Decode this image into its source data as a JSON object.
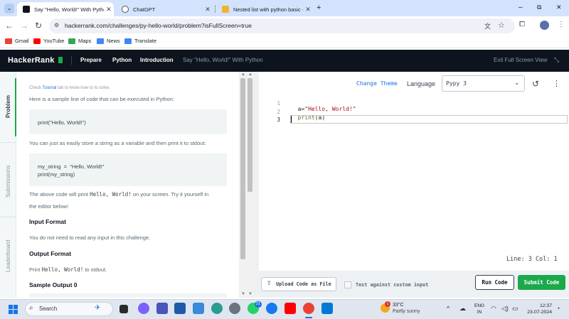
{
  "browser": {
    "tabs": [
      {
        "title": "Say \"Hello, World!\" With Pytho",
        "active": true
      },
      {
        "title": "ChatGPT",
        "active": false
      },
      {
        "title": "Nested list with python basic -",
        "active": false
      }
    ],
    "url": "hackerrank.com/challenges/py-hello-world/problem?isFullScreen=true",
    "bookmarks": [
      "Gmail",
      "YouTube",
      "Maps",
      "News",
      "Translate"
    ]
  },
  "header": {
    "logo": "HackerRank",
    "crumbs": [
      "Prepare",
      "Python",
      "Introduction"
    ],
    "challenge": "Say \"Hello, World!\" With Python",
    "exit_fullscreen": "Exit Full Screen View"
  },
  "side_tabs": [
    "Problem",
    "Submissions",
    "Leaderboard"
  ],
  "problem": {
    "tutorial_prefix": "Check",
    "tutorial_link": "Tutorial",
    "tutorial_suffix": "tab to know how to to solve.",
    "intro": "Here is a sample line of code that can be executed in Python:",
    "code1": "print(\"Hello, World!\")",
    "para2": "You can just as easily store a string as a variable and then print it to stdout:",
    "code2": "my_string  =  \"Hello, World!\"\nprint(my_string)",
    "para3_a": "The above code will print",
    "para3_code": "Hello, World!",
    "para3_b": "on your screen. Try it yourself in",
    "para3_c": "the editor below!",
    "input_format_title": "Input Format",
    "input_format_text": "You do not need to read any input in this challenge.",
    "output_format_title": "Output Format",
    "output_prefix": "Print",
    "output_code": "Hello, World!",
    "output_suffix": "to stdout.",
    "sample_output_title": "Sample Output 0"
  },
  "editor": {
    "change_theme": "Change Theme",
    "language_label": "Language",
    "language_value": "Pypy 3",
    "lines": [
      {
        "num": "1",
        "text_a": "a=",
        "text_b": "\"Hello, World!\""
      },
      {
        "num": "2",
        "text_a": "print",
        "text_b": "(a)"
      },
      {
        "num": "3",
        "text_a": "",
        "text_b": ""
      }
    ],
    "status": "Line: 3 Col: 1",
    "upload_label": "Upload Code as File",
    "custom_input_label": "Test against custom input",
    "run_label": "Run Code",
    "submit_label": "Submit Code"
  },
  "taskbar": {
    "search_label": "Search",
    "weather_temp": "33°C",
    "weather_desc": "Partly sunny",
    "language": "ENG",
    "region": "IN",
    "time": "12:37",
    "date": "23-07-2024",
    "notification_badge": "1",
    "whatsapp_badge": "21"
  },
  "colors": {
    "accent": "#1ba94c",
    "header_bg": "#0e141e",
    "link": "#1a73e8"
  }
}
